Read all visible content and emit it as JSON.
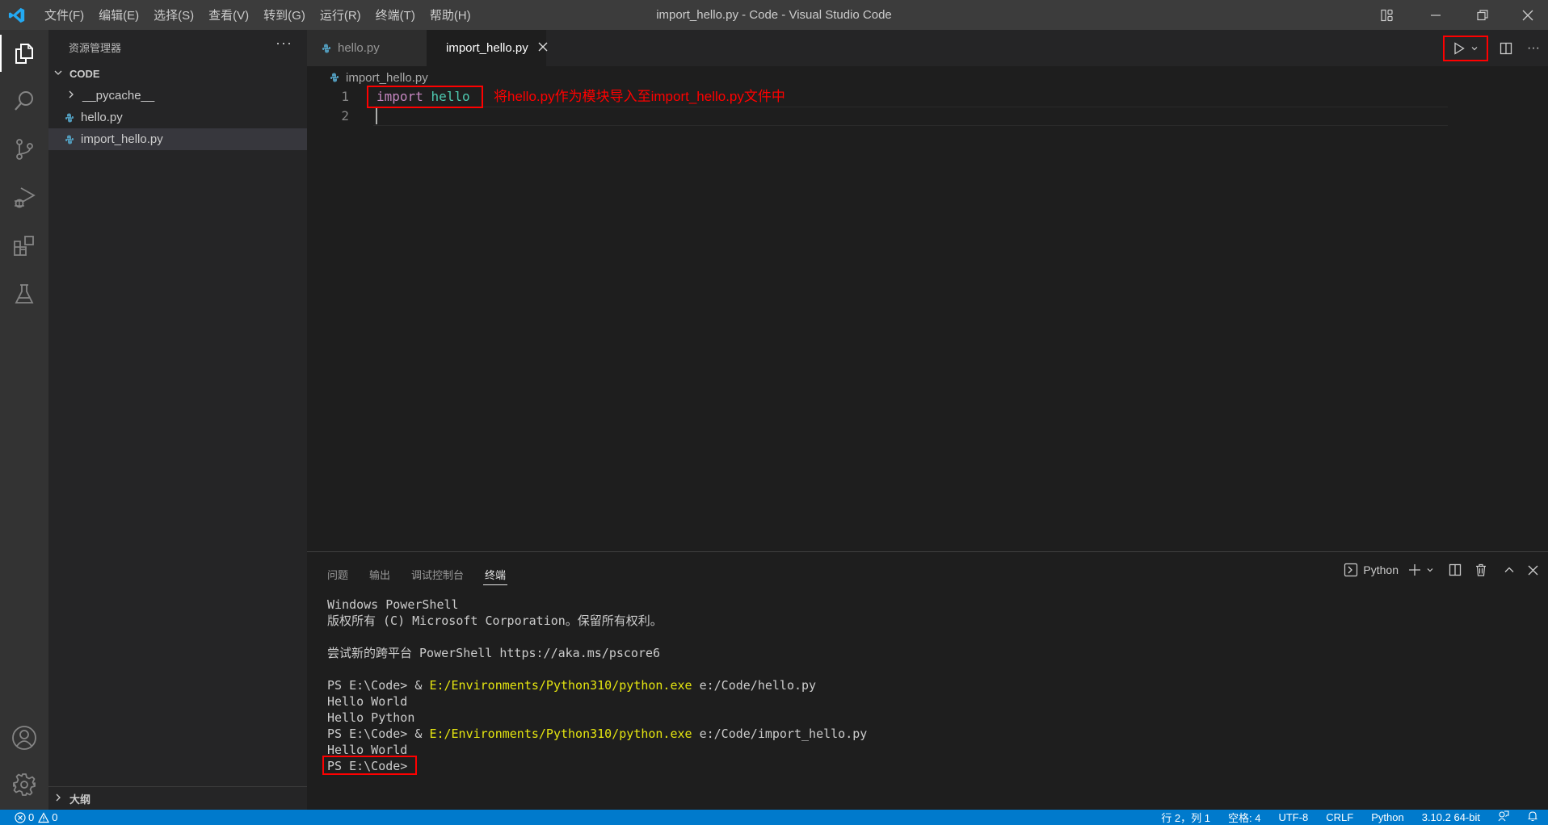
{
  "titlebar": {
    "window_title": "import_hello.py - Code - Visual Studio Code",
    "menu": [
      "文件(F)",
      "编辑(E)",
      "选择(S)",
      "查看(V)",
      "转到(G)",
      "运行(R)",
      "终端(T)",
      "帮助(H)"
    ],
    "controls": [
      "layout-icon",
      "minimize-icon",
      "restore-icon",
      "close-icon"
    ]
  },
  "activitybar": {
    "items": [
      "explorer",
      "search",
      "source-control",
      "run-and-debug",
      "extensions",
      "testing"
    ],
    "bottom": [
      "accounts",
      "manage"
    ],
    "active": "explorer"
  },
  "sidebar": {
    "title": "资源管理器",
    "more": "···",
    "section": "CODE",
    "tree": [
      {
        "label": "__pycache__",
        "type": "folder"
      },
      {
        "label": "hello.py",
        "type": "python"
      },
      {
        "label": "import_hello.py",
        "type": "python",
        "selected": true
      }
    ],
    "outline": "大纲"
  },
  "tabs": [
    {
      "label": "hello.py",
      "active": false
    },
    {
      "label": "import_hello.py",
      "active": true,
      "close": "×"
    }
  ],
  "editor": {
    "breadcrumb": "import_hello.py",
    "lines": [
      {
        "number": "1",
        "keyword": "import",
        "module": "hello"
      },
      {
        "number": "2",
        "keyword": "",
        "module": ""
      }
    ],
    "annotation": "将hello.py作为模块导入至import_hello.py文件中"
  },
  "panel": {
    "tabs": [
      "问题",
      "输出",
      "调试控制台",
      "终端"
    ],
    "active_tab": "终端",
    "terminal_name": "Python",
    "terminal": [
      {
        "text": "Windows PowerShell"
      },
      {
        "text": "版权所有 (C) Microsoft Corporation。保留所有权利。"
      },
      {
        "text": ""
      },
      {
        "text": "尝试新的跨平台 PowerShell https://aka.ms/pscore6"
      },
      {
        "text": ""
      },
      {
        "prompt": "PS E:\\Code> & ",
        "exe": "E:/Environments/Python310/python.exe",
        "arg": " e:/Code/hello.py"
      },
      {
        "text": "Hello World"
      },
      {
        "text": "Hello Python"
      },
      {
        "prompt": "PS E:\\Code> & ",
        "exe": "E:/Environments/Python310/python.exe",
        "arg": " e:/Code/import_hello.py"
      },
      {
        "text": "Hello World"
      },
      {
        "text": "PS E:\\Code>"
      }
    ]
  },
  "statusbar": {
    "errors": "0",
    "warnings": "0",
    "position": "行 2，列 1",
    "indent": "空格: 4",
    "encoding": "UTF-8",
    "eol": "CRLF",
    "language": "Python",
    "interpreter": "3.10.2 64-bit"
  },
  "colors": {
    "statusbar": "#007acc",
    "annotation": "#ff0000",
    "keyword": "#c586c0",
    "module": "#4ec9b0"
  }
}
